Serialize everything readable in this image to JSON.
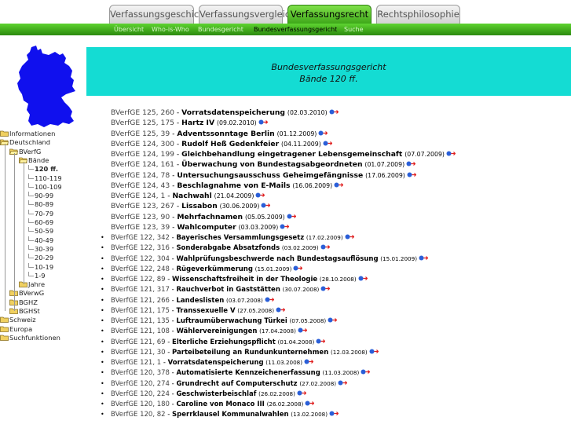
{
  "tabs": [
    {
      "label": "Verfassungsgeschichte",
      "active": false
    },
    {
      "label": "Verfassungsvergleich",
      "active": false
    },
    {
      "label": "Verfassungsrecht",
      "active": true
    },
    {
      "label": "Rechtsphilosophie",
      "active": false
    }
  ],
  "subnav": [
    {
      "label": "Übersicht",
      "current": false
    },
    {
      "label": "Who-is-Who",
      "current": false
    },
    {
      "label": "Bundesgericht",
      "current": false
    },
    {
      "label": "Bundesverfassungsgericht",
      "current": true
    },
    {
      "label": "Suche",
      "current": false
    }
  ],
  "header": {
    "line1": "Bundesverfassungsgericht",
    "line2": "Bände 120 ff."
  },
  "tree": [
    {
      "label": "Informationen"
    },
    {
      "label": "Deutschland"
    },
    {
      "label": "BVerfG"
    },
    {
      "label": "Bände"
    },
    {
      "label": "120 ff."
    },
    {
      "label": "110-119"
    },
    {
      "label": "100-109"
    },
    {
      "label": "90-99"
    },
    {
      "label": "80-89"
    },
    {
      "label": "70-79"
    },
    {
      "label": "60-69"
    },
    {
      "label": "50-59"
    },
    {
      "label": "40-49"
    },
    {
      "label": "30-39"
    },
    {
      "label": "20-29"
    },
    {
      "label": "10-19"
    },
    {
      "label": "1-9"
    },
    {
      "label": "Jahre"
    },
    {
      "label": "BVerwG"
    },
    {
      "label": "BGHZ"
    },
    {
      "label": "BGHSt"
    },
    {
      "label": "Schweiz"
    },
    {
      "label": "Europa"
    },
    {
      "label": "Suchfunktionen"
    }
  ],
  "decisions": [
    {
      "ref": "BVerfGE 125, 260",
      "title": "Vorratsdatenspeicherung",
      "date": "(02.03.2010)"
    },
    {
      "ref": "BVerfGE 125, 175",
      "title": "Hartz IV",
      "date": "(09.02.2010)"
    },
    {
      "ref": "BVerfGE 125, 39",
      "title": "Adventssonntage Berlin",
      "date": "(01.12.2009)"
    },
    {
      "ref": "BVerfGE 124, 300",
      "title": "Rudolf Heß Gedenkfeier",
      "date": "(04.11.2009)"
    },
    {
      "ref": "BVerfGE 124, 199",
      "title": "Gleichbehandlung eingetragener Lebensgemeinschaft",
      "date": "(07.07.2009)"
    },
    {
      "ref": "BVerfGE 124, 161",
      "title": "Überwachung von Bundestagsabgeordneten",
      "date": "(01.07.2009)"
    },
    {
      "ref": "BVerfGE 124, 78",
      "title": "Untersuchungsausschuss Geheimgefängnisse",
      "date": "(17.06.2009)"
    },
    {
      "ref": "BVerfGE 124, 43",
      "title": "Beschlagnahme von E-Mails",
      "date": "(16.06.2009)"
    },
    {
      "ref": "BVerfGE 124, 1",
      "title": "Nachwahl",
      "date": "(21.04.2009)"
    },
    {
      "ref": "BVerfGE 123, 267",
      "title": "Lissabon",
      "date": "(30.06.2009)"
    },
    {
      "ref": "BVerfGE 123, 90",
      "title": "Mehrfachnamen",
      "date": "(05.05.2009)"
    },
    {
      "ref": "BVerfGE 123, 39",
      "title": "Wahlcomputer",
      "date": "(03.03.2009)"
    },
    {
      "ref": "BVerfGE 122, 342",
      "title": "Bayerisches Versammlungsgesetz",
      "date": "(17.02.2009)"
    },
    {
      "ref": "BVerfGE 122, 316",
      "title": "Sonderabgabe Absatzfonds",
      "date": "(03.02.2009)"
    },
    {
      "ref": "BVerfGE 122, 304",
      "title": "Wahlprüfungsbeschwerde nach Bundestagsauflösung",
      "date": "(15.01.2009)"
    },
    {
      "ref": "BVerfGE 122, 248",
      "title": "Rügeverkümmerung",
      "date": "(15.01.2009)"
    },
    {
      "ref": "BVerfGE 122, 89",
      "title": "Wissenschaftsfreiheit in der Theologie",
      "date": "(28.10.2008)"
    },
    {
      "ref": "BVerfGE 121, 317",
      "title": "Rauchverbot in Gaststätten",
      "date": "(30.07.2008)"
    },
    {
      "ref": "BVerfGE 121, 266",
      "title": "Landeslisten",
      "date": "(03.07.2008)"
    },
    {
      "ref": "BVerfGE 121, 175",
      "title": "Transsexuelle V",
      "date": "(27.05.2008)"
    },
    {
      "ref": "BVerfGE 121, 135",
      "title": "Luftraumüberwachung Türkei",
      "date": "(07.05.2008)"
    },
    {
      "ref": "BVerfGE 121, 108",
      "title": "Wählervereinigungen",
      "date": "(17.04.2008)"
    },
    {
      "ref": "BVerfGE 121, 69",
      "title": "Elterliche Erziehungspflicht",
      "date": "(01.04.2008)"
    },
    {
      "ref": "BVerfGE 121, 30",
      "title": "Parteibeteilung an Rundunkunternehmen",
      "date": "(12.03.2008)"
    },
    {
      "ref": "BVerfGE 121, 1",
      "title": "Vorratsdatenspeicherung",
      "date": "(11.03.2008)"
    },
    {
      "ref": "BVerfGE 120, 378",
      "title": "Automatisierte Kennzeichenerfassung",
      "date": "(11.03.2008)"
    },
    {
      "ref": "BVerfGE 120, 274",
      "title": "Grundrecht auf Computerschutz",
      "date": "(27.02.2008)"
    },
    {
      "ref": "BVerfGE 120, 224",
      "title": "Geschwisterbeischlaf",
      "date": "(26.02.2008)"
    },
    {
      "ref": "BVerfGE 120, 180",
      "title": "Caroline von Monaco III",
      "date": "(26.02.2008)"
    },
    {
      "ref": "BVerfGE 120, 82",
      "title": "Sperrklausel Kommunalwahlen",
      "date": "(13.02.2008)"
    }
  ],
  "separator": " - ",
  "bullet": "•",
  "colors": {
    "accent_green": "#3fa81a",
    "header_cyan": "#14dcd3",
    "map_blue": "#1010ee",
    "folder_yellow": "#f0d060"
  }
}
